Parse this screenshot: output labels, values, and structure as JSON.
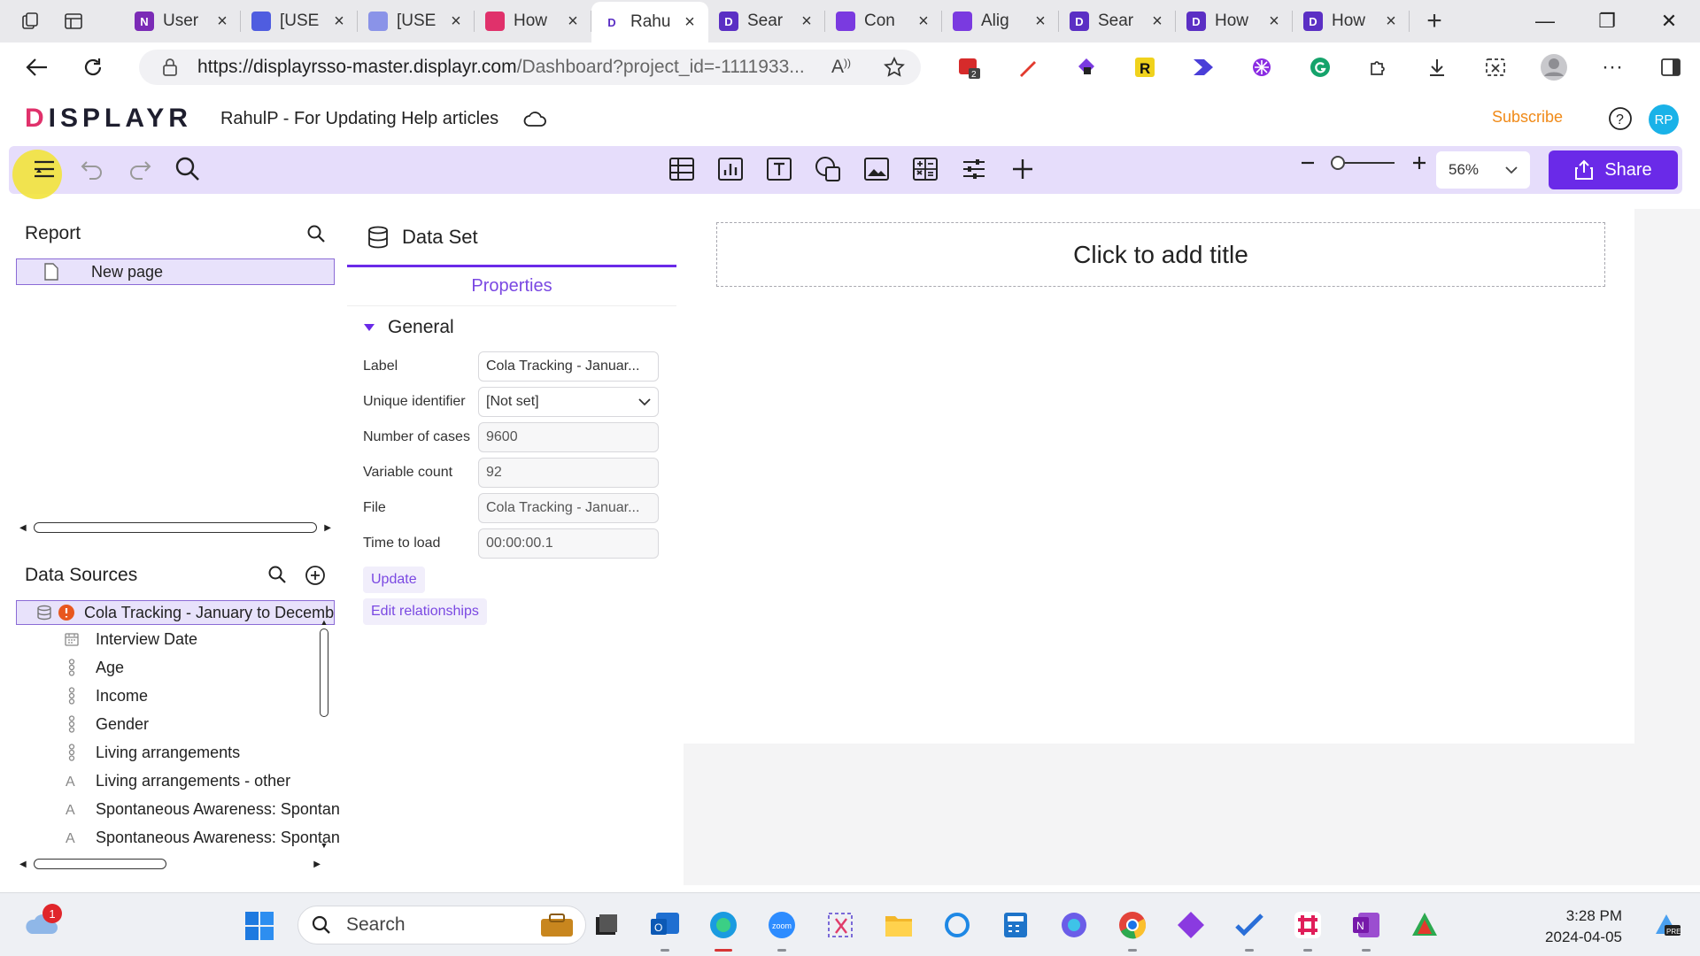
{
  "browser": {
    "tabs": [
      {
        "icon": "onenote-icon",
        "title": "User",
        "color": "#7b2bb6",
        "letter": "N"
      },
      {
        "icon": "diamond-icon",
        "title": "[USE",
        "color": "#4f5de0",
        "letter": ""
      },
      {
        "icon": "diamond-icon",
        "title": "[USE",
        "color": "#8a93e8",
        "letter": ""
      },
      {
        "icon": "triangle-icon",
        "title": "How",
        "color": "#e0316b",
        "letter": ""
      },
      {
        "icon": "displayr-icon",
        "title": "Rahu",
        "color": "#ffffff",
        "letter": "D"
      },
      {
        "icon": "displayr-icon",
        "title": "Sear",
        "color": "#5b2fc4",
        "letter": "D"
      },
      {
        "icon": "pen-icon",
        "title": "Con",
        "color": "#7a3ae0",
        "letter": ""
      },
      {
        "icon": "pen-icon",
        "title": "Alig",
        "color": "#7a3ae0",
        "letter": ""
      },
      {
        "icon": "displayr-icon",
        "title": "Sear",
        "color": "#5b2fc4",
        "letter": "D"
      },
      {
        "icon": "displayr-icon",
        "title": "How",
        "color": "#5b2fc4",
        "letter": "D"
      },
      {
        "icon": "displayr-icon",
        "title": "How",
        "color": "#5b2fc4",
        "letter": "D"
      }
    ],
    "url_host": "https://displayrsso-master.displayr.com",
    "url_path": "/Dashboard?project_id=-1111933..."
  },
  "app": {
    "logo": "ISPLAYR",
    "logo_first": "D",
    "project_title": "RahulP - For Updating Help articles",
    "subscribe": "Subscribe",
    "avatar": "RP",
    "zoom": "56%",
    "share": "Share"
  },
  "report": {
    "title": "Report",
    "pages": [
      "New page"
    ]
  },
  "data_sources": {
    "title": "Data Sources",
    "dataset": "Cola Tracking - January to December",
    "variables": [
      {
        "name": "Interview Date",
        "icon": "calendar-icon"
      },
      {
        "name": "Age",
        "icon": "categorical-icon"
      },
      {
        "name": "Income",
        "icon": "categorical-icon"
      },
      {
        "name": "Gender",
        "icon": "categorical-icon"
      },
      {
        "name": "Living arrangements",
        "icon": "categorical-icon"
      },
      {
        "name": "Living arrangements - other",
        "icon": "text-icon"
      },
      {
        "name": "Spontaneous Awareness: Spontaneous awareness",
        "icon": "text-icon"
      },
      {
        "name": "Spontaneous Awareness: Spontaneous awareness",
        "icon": "text-icon"
      }
    ]
  },
  "dataset_panel": {
    "title": "Data Set",
    "tab": "Properties",
    "section": "General",
    "props": [
      {
        "label": "Label",
        "value": "Cola Tracking - Januar..."
      },
      {
        "label": "Unique identifier",
        "value": "[Not set]"
      },
      {
        "label": "Number of cases",
        "value": "9600"
      },
      {
        "label": "Variable count",
        "value": "92"
      },
      {
        "label": "File",
        "value": "Cola Tracking - Januar..."
      },
      {
        "label": "Time to load",
        "value": "00:00:00.1"
      }
    ],
    "update": "Update",
    "edit_relationships": "Edit relationships"
  },
  "canvas": {
    "title_placeholder": "Click to add title"
  },
  "taskbar": {
    "search": "Search",
    "weather_badge": "1",
    "time": "3:28 PM",
    "date": "2024-04-05"
  }
}
